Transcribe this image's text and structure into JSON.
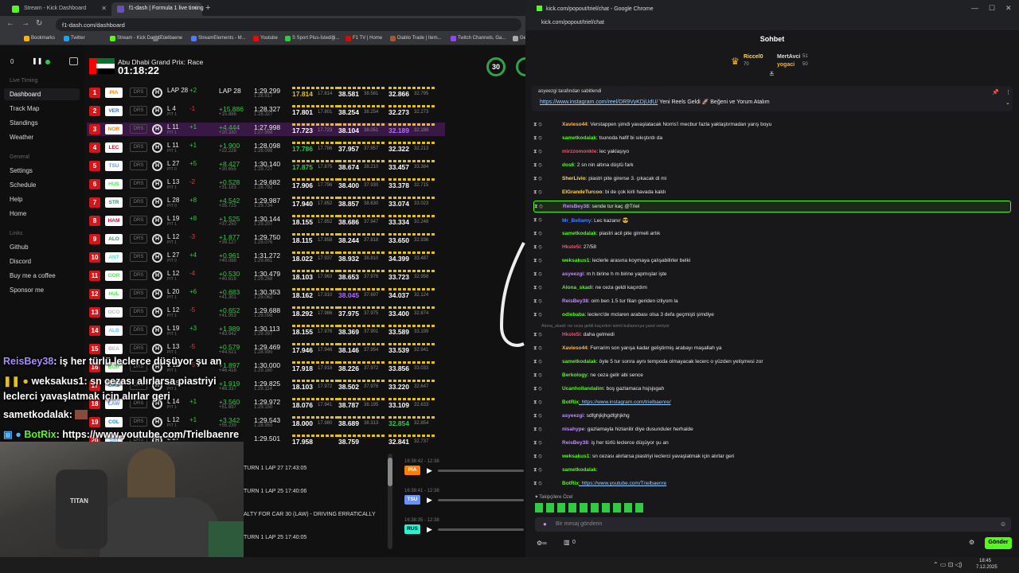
{
  "browser": {
    "tabs": [
      {
        "label": "Stream - Kick Dashboard",
        "color": "#53fc18"
      },
      {
        "label": "f1-dash | Formula 1 live timing",
        "color": "#e10600"
      }
    ],
    "url": "f1-dash.com/dashboard",
    "bookmarks": [
      "Bookmarks",
      "Twitter",
      "Stream - Kick Dashb...",
      "Trielbaene",
      "StreamElements - M...",
      "Youtube",
      "S Sport Plus-İstediği...",
      "F1 TV | Home",
      "Diablo Trade | Item...",
      "Twitch Channels, Ga...",
      "Ge"
    ]
  },
  "sidebar": {
    "live_timing_label": "Live Timing",
    "items_live": [
      "Dashboard",
      "Track Map",
      "Standings",
      "Weather"
    ],
    "general_label": "General",
    "items_general": [
      "Settings",
      "Schedule",
      "Help",
      "Home"
    ],
    "links_label": "Links",
    "items_links": [
      "Github",
      "Discord",
      "Buy me a coffee",
      "Sponsor me"
    ]
  },
  "header": {
    "delay": "0",
    "race_name": "Abu Dhabi Grand Prix: Race",
    "remaining": "01:18:22",
    "gauge_value": "30"
  },
  "timing": [
    {
      "pos": "1",
      "team": "PIA",
      "tc": "#ff8000",
      "tyre": "H",
      "lap": "LAP 28",
      "pit": "",
      "delta": "+2",
      "dc": "#2ecc40",
      "gap": "LAP 28",
      "gc": "#eee",
      "gap2": "",
      "lt": "1:29.299",
      "lt2": "1:28.917",
      "s1": "17.814",
      "s1b": "17.814",
      "s1c": "#e6c200",
      "s2": "38.581",
      "s2b": "38.581",
      "s2c": "#fff",
      "s3": "32.866",
      "s3b": "32.795",
      "s3c": "#fff"
    },
    {
      "pos": "2",
      "team": "VER",
      "tc": "#3671c6",
      "tyre": "H",
      "lap": "L 4",
      "pit": "PIT 1",
      "delta": "-1",
      "dc": "#e33",
      "gap": "+15.886",
      "gc": "#2ecc40",
      "gap2": "+15.886",
      "lt": "1:28.327",
      "lt2": "1:28.327",
      "s1": "17.801",
      "s1b": "17.801",
      "s1c": "#fff",
      "s2": "38.254",
      "s2b": "38.254",
      "s2c": "#fff",
      "s3": "32.273",
      "s3b": "32.273",
      "s3c": "#fff"
    },
    {
      "pos": "3",
      "team": "NOR",
      "tc": "#ff8000",
      "tyre": "H",
      "lap": "L 11",
      "pit": "PIT 1",
      "delta": "+1",
      "dc": "#2ecc40",
      "gap": "+4.444",
      "gc": "#2ecc40",
      "gap2": "+20.330",
      "lt": "1:27.998",
      "lt2": "1:27.998",
      "s1": "17.723",
      "s1b": "17.723",
      "s1c": "#fff",
      "s2": "38.104",
      "s2b": "38.051",
      "s2c": "#fff",
      "s3": "32.189",
      "s3b": "32.189",
      "s3c": "#b06cff"
    },
    {
      "pos": "4",
      "team": "LEC",
      "tc": "#e8002d",
      "tyre": "H",
      "lap": "L 11",
      "pit": "PIT 1",
      "delta": "+1",
      "dc": "#2ecc40",
      "gap": "+1.900",
      "gc": "#2ecc40",
      "gap2": "+22.228",
      "lt": "1:28.098",
      "lt2": "1:28.098",
      "s1": "17.786",
      "s1b": "17.786",
      "s1c": "#2ecc40",
      "s2": "37.957",
      "s2b": "37.957",
      "s2c": "#fff",
      "s3": "32.322",
      "s3b": "32.213",
      "s3c": "#fff"
    },
    {
      "pos": "5",
      "team": "TSU",
      "tc": "#6692ff",
      "tyre": "H",
      "lap": "L 27",
      "pit": "PIT 0",
      "delta": "+5",
      "dc": "#2ecc40",
      "gap": "+8.427",
      "gc": "#2ecc40",
      "gap2": "+30.655",
      "lt": "1:30.140",
      "lt2": "1:29.727",
      "s1": "17.875",
      "s1b": "17.875",
      "s1c": "#2ecc40",
      "s2": "38.674",
      "s2b": "38.210",
      "s2c": "#fff",
      "s3": "33.457",
      "s3b": "33.384",
      "s3c": "#fff"
    },
    {
      "pos": "6",
      "team": "HUS",
      "tc": "#52e252",
      "tyre": "H",
      "lap": "L 13",
      "pit": "PIT 1",
      "delta": "-2",
      "dc": "#e33",
      "gap": "+0.528",
      "gc": "#2ecc40",
      "gap2": "+31.183",
      "lt": "1:29.682",
      "lt2": "1:28.792",
      "s1": "17.906",
      "s1b": "17.796",
      "s1c": "#fff",
      "s2": "38.400",
      "s2b": "37.930",
      "s2c": "#fff",
      "s3": "33.378",
      "s3b": "32.715",
      "s3c": "#fff"
    },
    {
      "pos": "7",
      "team": "STR",
      "tc": "#229971",
      "tyre": "H",
      "lap": "L 28",
      "pit": "PIT 0",
      "delta": "+8",
      "dc": "#2ecc40",
      "gap": "+4.542",
      "gc": "#2ecc40",
      "gap2": "+35.725",
      "lt": "1:29.987",
      "lt2": "1:29.734",
      "s1": "17.940",
      "s1b": "17.852",
      "s1c": "#fff",
      "s2": "38.857",
      "s2b": "38.630",
      "s2c": "#fff",
      "s3": "33.074",
      "s3b": "33.023",
      "s3c": "#fff"
    },
    {
      "pos": "8",
      "team": "HAM",
      "tc": "#e8002d",
      "tyre": "H",
      "lap": "L 19",
      "pit": "PIT 1",
      "delta": "+8",
      "dc": "#2ecc40",
      "gap": "+1.525",
      "gc": "#2ecc40",
      "gap2": "+37.250",
      "lt": "1:30.144",
      "lt2": "1:29.207",
      "s1": "18.155",
      "s1b": "17.852",
      "s1c": "#fff",
      "s2": "38.686",
      "s2b": "37.947",
      "s2c": "#fff",
      "s3": "33.334",
      "s3b": "32.248",
      "s3c": "#fff"
    },
    {
      "pos": "9",
      "team": "ALO",
      "tc": "#229971",
      "tyre": "H",
      "lap": "L 12",
      "pit": "PIT 1",
      "delta": "-3",
      "dc": "#e33",
      "gap": "+1.877",
      "gc": "#2ecc40",
      "gap2": "+39.127",
      "lt": "1:29.750",
      "lt2": "1:29.076",
      "s1": "18.115",
      "s1b": "17.858",
      "s1c": "#fff",
      "s2": "38.244",
      "s2b": "37.818",
      "s2c": "#fff",
      "s3": "33.650",
      "s3b": "32.936",
      "s3c": "#fff"
    },
    {
      "pos": "10",
      "team": "ANT",
      "tc": "#27f4d2",
      "tyre": "H",
      "lap": "L 27",
      "pit": "PIT 0",
      "delta": "+4",
      "dc": "#2ecc40",
      "gap": "+0.961",
      "gc": "#2ecc40",
      "gap2": "+40.088",
      "lt": "1:31.272",
      "lt2": "1:29.861",
      "s1": "18.022",
      "s1b": "17.937",
      "s1c": "#fff",
      "s2": "38.932",
      "s2b": "38.810",
      "s2c": "#fff",
      "s3": "34.399",
      "s3b": "33.487",
      "s3c": "#fff"
    },
    {
      "pos": "11",
      "team": "GOR",
      "tc": "#52e252",
      "tyre": "H",
      "lap": "L 12",
      "pit": "PIT 1",
      "delta": "-4",
      "dc": "#e33",
      "gap": "+0.530",
      "gc": "#2ecc40",
      "gap2": "+40.618",
      "lt": "1:30.479",
      "lt2": "1:29.268",
      "s1": "18.103",
      "s1b": "17.963",
      "s1c": "#fff",
      "s2": "38.653",
      "s2b": "37.976",
      "s2c": "#fff",
      "s3": "33.723",
      "s3b": "32.958",
      "s3c": "#fff"
    },
    {
      "pos": "12",
      "team": "HUL",
      "tc": "#52e252",
      "tyre": "H",
      "lap": "L 20",
      "pit": "PIT 1",
      "delta": "+6",
      "dc": "#2ecc40",
      "gap": "+0.683",
      "gc": "#2ecc40",
      "gap2": "+41.301",
      "lt": "1:30.353",
      "lt2": "1:29.062",
      "s1": "18.162",
      "s1b": "17.910",
      "s1c": "#fff",
      "s2": "38.045",
      "s2b": "37.697",
      "s2c": "#b06cff",
      "s3": "34.037",
      "s3b": "32.124",
      "s3c": "#fff"
    },
    {
      "pos": "13",
      "team": "OCO",
      "tc": "#b6babd",
      "tyre": "H",
      "lap": "L 12",
      "pit": "PIT 1",
      "delta": "-5",
      "dc": "#e33",
      "gap": "+0.652",
      "gc": "#2ecc40",
      "gap2": "+41.953",
      "lt": "1:29.688",
      "lt2": "1:29.098",
      "s1": "18.292",
      "s1b": "17.986",
      "s1c": "#fff",
      "s2": "37.975",
      "s2b": "37.975",
      "s2c": "#fff",
      "s3": "33.400",
      "s3b": "32.874",
      "s3c": "#fff"
    },
    {
      "pos": "14",
      "team": "ALB",
      "tc": "#64c4ff",
      "tyre": "H",
      "lap": "L 19",
      "pit": "PIT 1",
      "delta": "+3",
      "dc": "#2ecc40",
      "gap": "+1.989",
      "gc": "#2ecc40",
      "gap2": "+43.942",
      "lt": "1:30.113",
      "lt2": "1:29.397",
      "s1": "18.155",
      "s1b": "17.976",
      "s1c": "#fff",
      "s2": "38.369",
      "s2b": "37.901",
      "s2c": "#fff",
      "s3": "33.589",
      "s3b": "33.199",
      "s3c": "#fff"
    },
    {
      "pos": "15",
      "team": "BEA",
      "tc": "#b6babd",
      "tyre": "H",
      "lap": "L 13",
      "pit": "PIT 1",
      "delta": "-5",
      "dc": "#e33",
      "gap": "+0.579",
      "gc": "#2ecc40",
      "gap2": "+44.521",
      "lt": "1:29.469",
      "lt2": "1:28.990",
      "s1": "17.946",
      "s1b": "17.946",
      "s1c": "#fff",
      "s2": "38.146",
      "s2b": "37.954",
      "s2c": "#fff",
      "s3": "33.539",
      "s3b": "32.941",
      "s3c": "#fff"
    },
    {
      "pos": "16",
      "team": "BOR",
      "tc": "#52e252",
      "tyre": "H",
      "lap": "L 12",
      "pit": "PIT 1",
      "delta": "-5",
      "dc": "#e33",
      "gap": "+1.897",
      "gc": "#2ecc40",
      "gap2": "+46.418",
      "lt": "1:30.000",
      "lt2": "1:29.160",
      "s1": "17.918",
      "s1b": "17.918",
      "s1c": "#fff",
      "s2": "38.226",
      "s2b": "37.972",
      "s2c": "#fff",
      "s3": "33.856",
      "s3b": "33.033",
      "s3c": "#fff"
    },
    {
      "pos": "17",
      "team": "GAS",
      "tc": "#0093cc",
      "tyre": "H",
      "lap": "L 15",
      "pit": "PIT 1",
      "delta": "-1",
      "dc": "#e33",
      "gap": "+1.919",
      "gc": "#2ecc40",
      "gap2": "+48.337",
      "lt": "1:29.825",
      "lt2": "1:29.114",
      "s1": "18.103",
      "s1b": "17.972",
      "s1c": "#fff",
      "s2": "38.502",
      "s2b": "37.976",
      "s2c": "#fff",
      "s3": "33.220",
      "s3b": "32.647",
      "s3c": "#fff"
    },
    {
      "pos": "18",
      "team": "LAW",
      "tc": "#6692ff",
      "tyre": "H",
      "lap": "L 14",
      "pit": "PIT 1",
      "delta": "+1",
      "dc": "#2ecc40",
      "gap": "+3.560",
      "gc": "#2ecc40",
      "gap2": "+51.897",
      "lt": "1:29.972",
      "lt2": "1:29.150",
      "s1": "18.076",
      "s1b": "17.941",
      "s1c": "#fff",
      "s2": "38.787",
      "s2b": "38.195",
      "s2c": "#fff",
      "s3": "33.109",
      "s3b": "32.633",
      "s3c": "#fff"
    },
    {
      "pos": "19",
      "team": "COL",
      "tc": "#0093cc",
      "tyre": "H",
      "lap": "L 12",
      "pit": "PIT 1",
      "delta": "+1",
      "dc": "#2ecc40",
      "gap": "+3.342",
      "gc": "#2ecc40",
      "gap2": "+55.239",
      "lt": "1:29.543",
      "lt2": "1:28.950",
      "s1": "18.000",
      "s1b": "17.980",
      "s1c": "#fff",
      "s2": "38.689",
      "s2b": "38.313",
      "s2c": "#fff",
      "s3": "32.854",
      "s3b": "32.854",
      "s3c": "#2ecc40"
    },
    {
      "pos": "20",
      "team": "SAI",
      "tc": "#64c4ff",
      "tyre": "H",
      "lap": "L 27",
      "pit": "PIT 0",
      "delta": "",
      "dc": "#e33",
      "gap": "",
      "gc": "#2ecc40",
      "gap2": "",
      "lt": "1:29.501",
      "lt2": "",
      "s1": "17.958",
      "s1b": "",
      "s1c": "#fff",
      "s2": "38.759",
      "s2b": "",
      "s2c": "#fff",
      "s3": "32.841",
      "s3b": "32.737",
      "s3c": "#fff"
    }
  ],
  "race_control": [
    "TURN 1 LAP 27 17:43:05",
    "TURN 1 LAP 25 17:40:06",
    "ALTY FOR CAR 30 (LAW) - DRIVING ERRATICALLY",
    "TURN 1 LAP 25 17:40:05"
  ],
  "radios": [
    {
      "time": "16:38:42 - 12:38",
      "driver": "PIA",
      "color": "#ff8000"
    },
    {
      "time": "16:38:41 - 12:38",
      "driver": "TSU",
      "color": "#6692ff"
    },
    {
      "time": "16:38:35 - 12:38",
      "driver": "RUS",
      "color": "#27f4d2"
    }
  ],
  "overlay": [
    {
      "user": "ReisBey38",
      "text": ": iş her türlü leclerce düşüyor şu an",
      "color": "#9a7cff"
    },
    {
      "user": "weksakus1",
      "text": ": sn cezası alırlarsa piastriyi",
      "color": "#fff"
    },
    {
      "user": "",
      "text": "leclerci yavaşlatmak için alırlar geri",
      "color": "#fff"
    },
    {
      "user": "sametkodalak",
      "text": ":",
      "color": "#fff"
    },
    {
      "user": "BotRix",
      "text": ": https://www.youtube.com/Trielbaenre",
      "color": "#53fc18"
    }
  ],
  "cam": {
    "brand": "TITAN"
  },
  "chat": {
    "window_title": "kick.com/popout/triel/chat - Google Chrome",
    "url": "kick.com/popout/triel/chat",
    "heading": "Sohbet",
    "top_gifters": [
      {
        "name": "Riccel0",
        "count": "70"
      },
      {
        "name": "MertAvci",
        "count": "51"
      },
      {
        "name": "yogaci",
        "count": "50"
      }
    ],
    "pinned_by": "asyeezgi tarafından sabitlendi",
    "pinned_link": "https://www.instagram.com/reel/DR9VyKDjUdU/",
    "pinned_text": " Yeni Reels Geldi 🚀 Beğeni ve Yorum Atalım",
    "messages": [
      {
        "user": "Xavieso44",
        "color": "#ffb84d",
        "text": ": Verstappen şimdi yavaşlatacak Norris'i mecbur fazla yaklaştırmadan yarış boyu",
        "link": false
      },
      {
        "user": "sametkodalak",
        "color": "#53fc18",
        "text": ": tsunoda hafif bi sıkıştırdı da",
        "link": false
      },
      {
        "user": "mirzzomonkle",
        "color": "#ff4d6a",
        "text": ": lec yaklaşıyo",
        "link": false
      },
      {
        "user": "dos6",
        "color": "#53fc18",
        "text": ": 2 sn nin altına düştü fark",
        "link": false
      },
      {
        "user": "SherLivio",
        "color": "#ffd84d",
        "text": ": piastri pite girerse 3. çıkacak di mi",
        "link": false
      },
      {
        "user": "ElGrandeTurcoo",
        "color": "#ffd84d",
        "text": ": bi de çok kirli havada kaldı",
        "link": false
      },
      {
        "user": "ReisBey38",
        "color": "#c08aff",
        "text": ": sende tur kaç @Triel",
        "link": false
      },
      {
        "user": "Mr_Bellamy",
        "color": "#4d7dff",
        "text": ": Lec kazanır 😎",
        "link": false
      },
      {
        "user": "sametkodalak",
        "color": "#53fc18",
        "text": ": piastri acil pite girmeli artık",
        "link": false
      },
      {
        "user": "Hkste5i",
        "color": "#ff4d6a",
        "text": ": 27/58",
        "link": false
      },
      {
        "user": "weksakus1",
        "color": "#53fc18",
        "text": ": leclerle arasına koymaya çalışabilirler belki",
        "link": false
      },
      {
        "user": "asyeezgi",
        "color": "#c08aff",
        "text": ": m h birine h m birine yapmışlar işte",
        "link": false
      },
      {
        "user": "Alona_skadi",
        "color": "#53fc18",
        "text": ": ne ceza geldi kaçırdım",
        "link": false
      },
      {
        "user": "ReisBey38",
        "color": "#c08aff",
        "text": ": oim ben 1.5 tur filan geriden izliyom la",
        "link": false
      },
      {
        "user": "odiebaba",
        "color": "#53fc18",
        "text": ": leclerc'de mclaren arabası olsa 3 defa geçmişti şimdiye",
        "link": false
      },
      {
        "user": "Hkste5i",
        "color": "#ff4d6a",
        "text": ": daha gelmedi",
        "link": false
      },
      {
        "user": "Xavieso44",
        "color": "#ffb84d",
        "text": ": Ferrarim son yarışa kadar geliştirmiş arabayı maşallah ya",
        "link": false
      },
      {
        "user": "sametkodalak",
        "color": "#53fc18",
        "text": ": öyle 5 tur sonra aynı tempoda olmayacak lecerc o yüzden yetişmesi zor",
        "link": false
      },
      {
        "user": "Berkology",
        "color": "#53fc18",
        "text": ": ne ceza gelir abi sence",
        "link": false
      },
      {
        "user": "Ucanhollandalim",
        "color": "#53fc18",
        "text": ": boş gazlamaca hsjsjsgah",
        "link": false
      },
      {
        "user": "BotRix",
        "color": "#53fc18",
        "text": ": https://www.instagram.com/trielbaenre/",
        "link": true
      },
      {
        "user": "asyeezgi",
        "color": "#c08aff",
        "text": ": sdfghjkjhgdfghjkhg",
        "link": false
      },
      {
        "user": "nisahype",
        "color": "#c08aff",
        "text": ": gazlamayla hizlanilir diye dusunduler herhalde",
        "link": false
      },
      {
        "user": "ReisBey38",
        "color": "#c08aff",
        "text": ": iş her türlü leclerce düşüyor şu an",
        "link": false
      },
      {
        "user": "weksakus1",
        "color": "#53fc18",
        "text": ": sn cezası alırlarsa piastriyi leclerci yavaşlatmak için alırlar geri",
        "link": false
      },
      {
        "user": "sametkodalak",
        "color": "#53fc18",
        "text": ":",
        "link": false
      },
      {
        "user": "BotRix",
        "color": "#53fc18",
        "text": ": https://www.youtube.com/Trielbaenre",
        "link": true
      }
    ],
    "reply_hint": "Alona_skadi: ne ceza geldi kaçırdım isimli kullanıcıya yanıt veriyor",
    "emote_label": "Takipçilere Özel",
    "input_placeholder": "Bir mesaj gönderin",
    "viewer_count": "0",
    "send_label": "Gönder"
  },
  "taskbar": {
    "time": "18:45",
    "date": "7.12.2025"
  }
}
